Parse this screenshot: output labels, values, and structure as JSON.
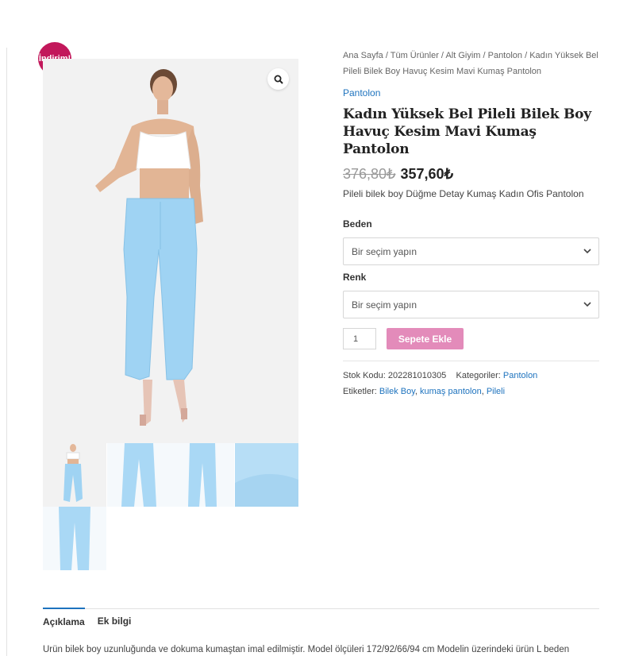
{
  "badge": {
    "sale": "İndirim!"
  },
  "icons": {
    "zoom": "magnifier-icon",
    "chevron": "chevron-down-icon"
  },
  "breadcrumb": {
    "items": [
      "Ana Sayfa",
      "Tüm Ürünler",
      "Alt Giyim",
      "Pantolon"
    ],
    "separator": " / ",
    "current": "Kadın Yüksek Bel Pileli Bilek Boy Havuç Kesim Mavi Kumaş Pantolon"
  },
  "product": {
    "category": "Pantolon",
    "title": "Kadın Yüksek Bel Pileli Bilek Boy Havuç Kesim Mavi Kumaş Pantolon",
    "old_price": "376,80₺",
    "price": "357,60₺",
    "short_description": "Pileli bilek boy Düğme Detay Kumaş Kadın Ofis Pantolon"
  },
  "variations": {
    "size_label": "Beden",
    "size_placeholder": "Bir seçim yapın",
    "color_label": "Renk",
    "color_placeholder": "Bir seçim yapın"
  },
  "cart": {
    "quantity": "1",
    "add_label": "Sepete Ekle"
  },
  "meta": {
    "sku_label": "Stok Kodu:",
    "sku": "202281010305",
    "categories_label": "Kategoriler:",
    "categories": [
      "Pantolon"
    ],
    "tags_label": "Etiketler:",
    "tags": [
      "Bilek Boy",
      "kumaş pantolon",
      "Pileli"
    ]
  },
  "tabs": [
    {
      "label": "Açıklama"
    },
    {
      "label": "Ek bilgi"
    }
  ],
  "description": "Ürün bilek boy uzunluğunda ve dokuma kumaştan imal edilmiştir. Model ölçüleri 172/92/66/94 cm Modelin üzerindeki ürün L beden",
  "colors": {
    "accent": "#1e73be",
    "badge": "#c2185b",
    "button": "#e38bba",
    "pants": "#9fd3f3"
  }
}
